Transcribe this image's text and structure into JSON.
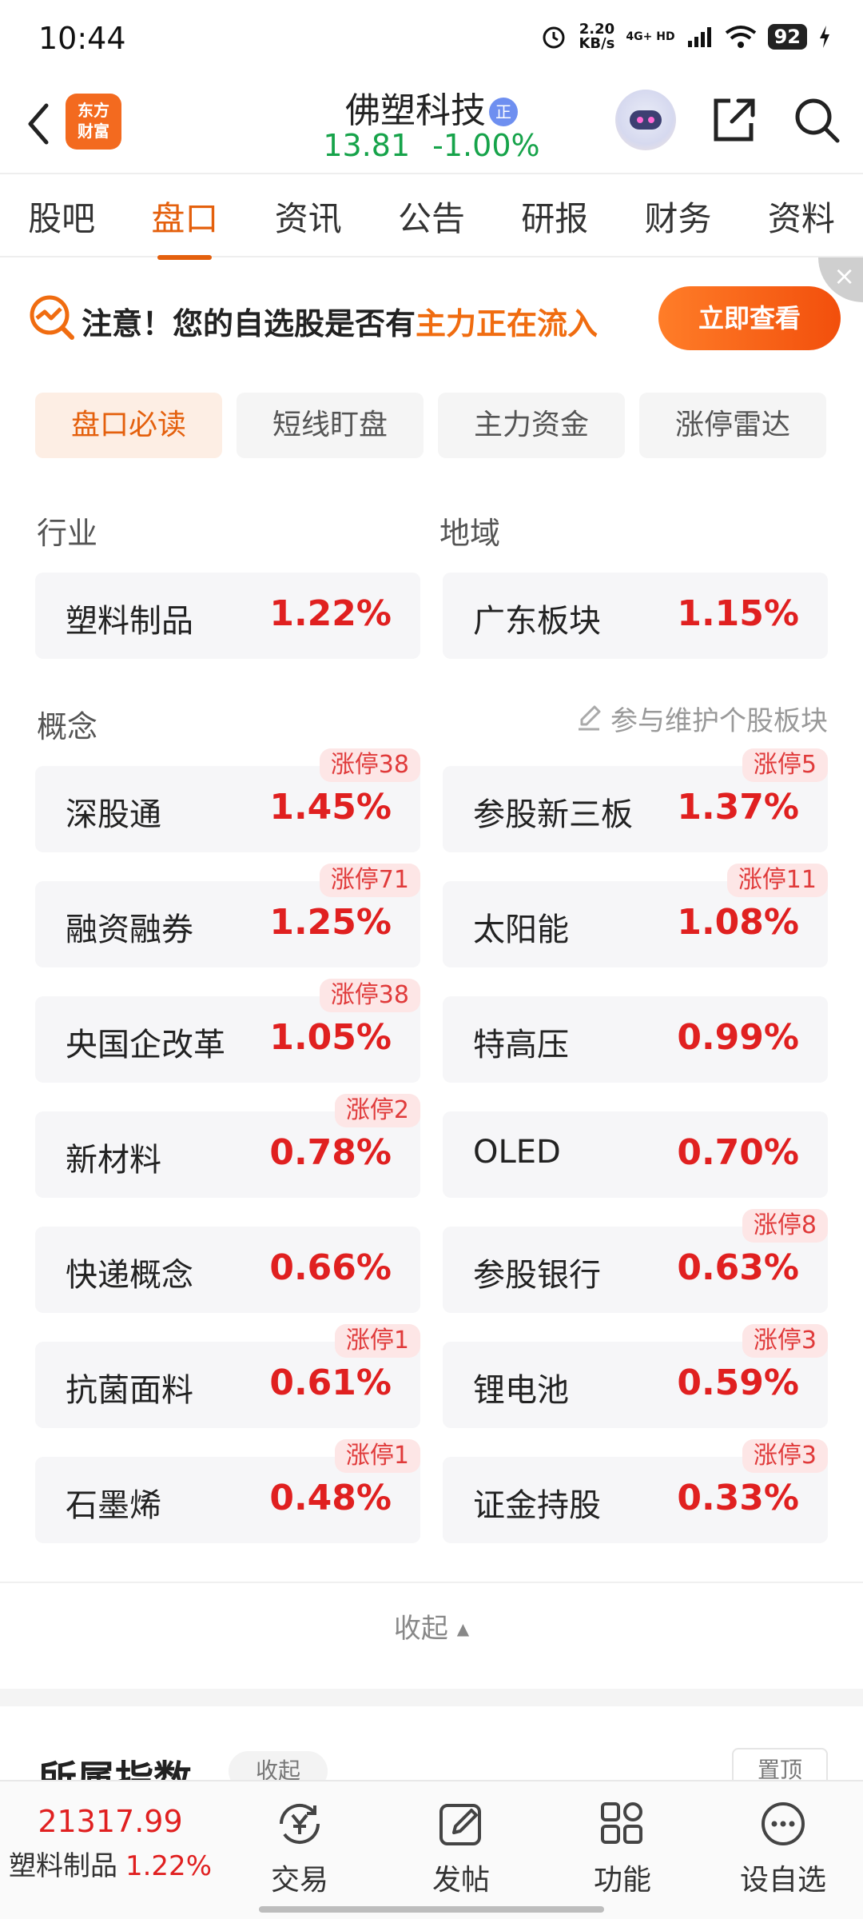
{
  "status_bar": {
    "time": "10:44",
    "net_speed_value": "2.20",
    "net_speed_unit": "KB/s",
    "network": "4G+ HD",
    "battery": "92"
  },
  "header": {
    "logo_line1": "东方",
    "logo_line2": "财富",
    "stock_name": "佛塑科技",
    "badge": "正",
    "price": "13.81",
    "change": "-1.00%"
  },
  "tabs": [
    "股吧",
    "盘口",
    "资讯",
    "公告",
    "研报",
    "财务",
    "资料"
  ],
  "active_tab": 1,
  "banner": {
    "text_prefix": "注意！您的自选股是否有",
    "text_highlight": "主力正在流入",
    "button": "立即查看"
  },
  "subtabs": [
    "盘口必读",
    "短线盯盘",
    "主力资金",
    "涨停雷达"
  ],
  "sections": {
    "industry_label": "行业",
    "region_label": "地域",
    "concept_label": "概念",
    "maintain_link": "参与维护个股板块"
  },
  "industry": {
    "name": "塑料制品",
    "pct": "1.22%"
  },
  "region": {
    "name": "广东板块",
    "pct": "1.15%"
  },
  "concepts": [
    {
      "name": "深股通",
      "pct": "1.45%",
      "badge": "涨停38"
    },
    {
      "name": "参股新三板",
      "pct": "1.37%",
      "badge": "涨停5"
    },
    {
      "name": "融资融券",
      "pct": "1.25%",
      "badge": "涨停71"
    },
    {
      "name": "太阳能",
      "pct": "1.08%",
      "badge": "涨停11"
    },
    {
      "name": "央国企改革",
      "pct": "1.05%",
      "badge": "涨停38"
    },
    {
      "name": "特高压",
      "pct": "0.99%",
      "badge": ""
    },
    {
      "name": "新材料",
      "pct": "0.78%",
      "badge": "涨停2"
    },
    {
      "name": "OLED",
      "pct": "0.70%",
      "badge": ""
    },
    {
      "name": "快递概念",
      "pct": "0.66%",
      "badge": ""
    },
    {
      "name": "参股银行",
      "pct": "0.63%",
      "badge": "涨停8"
    },
    {
      "name": "抗菌面料",
      "pct": "0.61%",
      "badge": "涨停1"
    },
    {
      "name": "锂电池",
      "pct": "0.59%",
      "badge": "涨停3"
    },
    {
      "name": "石墨烯",
      "pct": "0.48%",
      "badge": "涨停1"
    },
    {
      "name": "证金持股",
      "pct": "0.33%",
      "badge": "涨停3"
    }
  ],
  "collapse_label": "收起",
  "index_section": {
    "title": "所属指数",
    "collapse": "收起",
    "pin": "置顶"
  },
  "bottom_bar": {
    "index_value": "21317.99",
    "index_name": "塑料制品",
    "index_pct": "1.22%",
    "items": [
      "交易",
      "发帖",
      "功能",
      "设自选"
    ]
  },
  "colors": {
    "accent": "#e4600d",
    "up": "#e02020",
    "down": "#16a34a"
  }
}
